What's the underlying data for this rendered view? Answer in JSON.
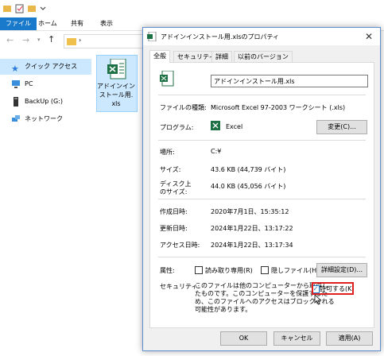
{
  "explorer": {
    "ribbon_tabs": [
      "ファイル",
      "ホーム",
      "共有",
      "表示"
    ],
    "address_sep": "›",
    "sidebar": [
      {
        "label": "クイック アクセス",
        "icon": "star-icon"
      },
      {
        "label": "PC",
        "icon": "pc-icon"
      },
      {
        "label": "BackUp (G:)",
        "icon": "drive-icon"
      },
      {
        "label": "ネットワーク",
        "icon": "network-icon"
      }
    ],
    "file": {
      "label_lines": [
        "アドインイン",
        "ストール用.",
        "xls"
      ]
    }
  },
  "dialog": {
    "title": "アドインインストール用.xlsのプロパティ",
    "close_glyph": "✕",
    "tabs": [
      "全般",
      "セキュリティ",
      "詳細",
      "以前のバージョン"
    ],
    "filename": "アドインインストール用.xls",
    "rows": {
      "type_label": "ファイルの種類:",
      "type_value": "Microsoft Excel 97-2003 ワークシート (.xls)",
      "program_label": "プログラム:",
      "program_value": "Excel",
      "change_button": "変更(C)...",
      "location_label": "場所:",
      "location_value": "C:¥",
      "size_label": "サイズ:",
      "size_value": "43.6 KB (44,739 バイト)",
      "disk_label_1": "ディスク上",
      "disk_label_2": "のサイズ:",
      "disk_value": "44.0 KB (45,056 バイト)",
      "created_label": "作成日時:",
      "created_value": "2020年7月1日、15:35:12",
      "modified_label": "更新日時:",
      "modified_value": "2024年1月22日、13:17:22",
      "accessed_label": "アクセス日時:",
      "accessed_value": "2024年1月22日、13:17:34",
      "attr_label": "属性:",
      "readonly_label": "読み取り専用(R)",
      "hidden_label": "隠しファイル(H)",
      "advanced_button": "詳細設定(D)...",
      "security_label": "セキュリティ:",
      "security_lines": [
        "このファイルは他のコンピューターから取得し",
        "たものです。このコンピューターを保護するた",
        "め、このファイルへのアクセスはブロックされる",
        "可能性があります。"
      ],
      "allow_label": "許可する(K)"
    },
    "buttons": {
      "ok": "OK",
      "cancel": "キャンセル",
      "apply": "適用(A)"
    },
    "colors": {
      "highlight": "#e02020",
      "excel_green": "#1d7145",
      "accent": "#1979ca"
    }
  }
}
